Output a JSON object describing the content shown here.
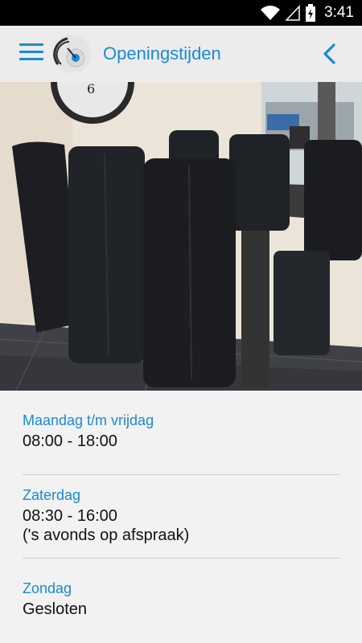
{
  "status_bar": {
    "time": "3:41",
    "icons": [
      "wifi-icon",
      "signal-icon",
      "battery-icon"
    ]
  },
  "app_bar": {
    "title": "Openingstijden",
    "menu_icon": "hamburger-menu-icon",
    "back_icon": "chevron-left-icon",
    "accent_color": "#1a8ad4"
  },
  "hero": {
    "description_icon": "photo-dining-table-chairs"
  },
  "hours": [
    {
      "day": "Maandag t/m vrijdag",
      "time": "08:00 - 18:00"
    },
    {
      "day": "Zaterdag",
      "time": "08:30 - 16:00",
      "note": "('s avonds op afspraak)"
    },
    {
      "day": "Zondag",
      "time": "Gesloten"
    }
  ]
}
